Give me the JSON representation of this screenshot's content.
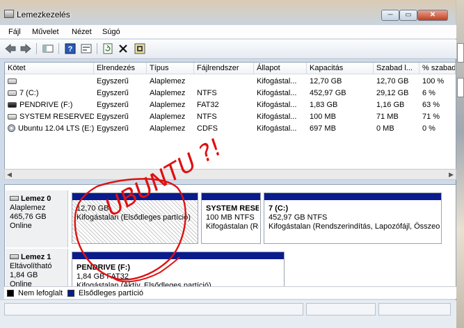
{
  "window": {
    "title": "Lemezkezelés",
    "minimize": "─",
    "maximize": "▭",
    "close": "✕"
  },
  "menu": [
    "Fájl",
    "Művelet",
    "Nézet",
    "Súgó"
  ],
  "toolbar": {
    "icons": [
      "back-arrow-icon",
      "forward-arrow-icon",
      "panel-icon",
      "help-icon",
      "properties-icon",
      "refresh-icon",
      "delete-icon",
      "settings-icon"
    ]
  },
  "table": {
    "columns": [
      "Kötet",
      "Elrendezés",
      "Típus",
      "Fájlrendszer",
      "Állapot",
      "Kapacitás",
      "Szabad l...",
      "% szabad"
    ],
    "rows": [
      {
        "volume": "",
        "layout": "Egyszerű",
        "type": "Alaplemez",
        "fs": "",
        "status": "Kifogástal...",
        "capacity": "12,70 GB",
        "free": "12,70 GB",
        "pct": "100 %",
        "icon": "drive"
      },
      {
        "volume": "7 (C:)",
        "layout": "Egyszerű",
        "type": "Alaplemez",
        "fs": "NTFS",
        "status": "Kifogástal...",
        "capacity": "452,97 GB",
        "free": "29,12 GB",
        "pct": "6 %",
        "icon": "drive"
      },
      {
        "volume": "PENDRIVE (F:)",
        "layout": "Egyszerű",
        "type": "Alaplemez",
        "fs": "FAT32",
        "status": "Kifogástal...",
        "capacity": "1,83 GB",
        "free": "1,16 GB",
        "pct": "63 %",
        "icon": "usb"
      },
      {
        "volume": "SYSTEM RESERVED",
        "layout": "Egyszerű",
        "type": "Alaplemez",
        "fs": "NTFS",
        "status": "Kifogástal...",
        "capacity": "100 MB",
        "free": "71 MB",
        "pct": "71 %",
        "icon": "drive"
      },
      {
        "volume": "Ubuntu 12.04 LTS (E:)",
        "layout": "Egyszerű",
        "type": "Alaplemez",
        "fs": "CDFS",
        "status": "Kifogástal...",
        "capacity": "697 MB",
        "free": "0 MB",
        "pct": "0 %",
        "icon": "cd"
      }
    ]
  },
  "disks": [
    {
      "name": "Lemez 0",
      "type": "Alaplemez",
      "size": "465,76 GB",
      "state": "Online",
      "partitions": [
        {
          "name": "",
          "line1": "12,70 GB",
          "line2": "Kifogástalan (Elsődleges partíció)"
        },
        {
          "name": "SYSTEM RESER",
          "line1": "100 MB NTFS",
          "line2": "Kifogástalan (Re"
        },
        {
          "name": "7  (C:)",
          "line1": "452,97 GB NTFS",
          "line2": "Kifogástalan (Rendszerindítás, Lapozófájl, Összeom"
        }
      ]
    },
    {
      "name": "Lemez 1",
      "type": "Eltávolítható",
      "size": "1,84 GB",
      "state": "Online",
      "partitions": [
        {
          "name": "PENDRIVE  (F:)",
          "line1": "1,84 GB FAT32",
          "line2": "Kifogástalan (Aktív, Elsődleges partíció)"
        }
      ]
    }
  ],
  "legend": [
    {
      "label": "Nem lefoglalt",
      "color": "#000000"
    },
    {
      "label": "Elsődleges partíció",
      "color": "#0a1c8c"
    }
  ],
  "annotation": {
    "text": "UBUNTU ?!",
    "color": "#e01010"
  }
}
